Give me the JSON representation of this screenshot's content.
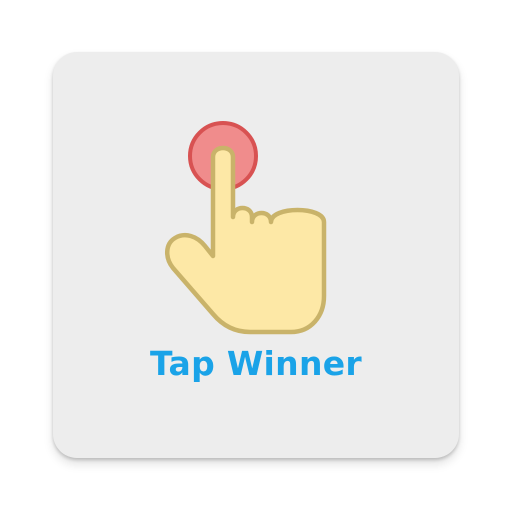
{
  "app": {
    "name": "Tap Winner",
    "icon": "tap-finger-icon"
  },
  "colors": {
    "tile_background": "#ededed",
    "title_text": "#1aa3e8",
    "tap_circle_fill": "#f08c8c",
    "tap_circle_stroke": "#d85252",
    "hand_fill": "#fde8a6",
    "hand_stroke": "#c9b36a"
  }
}
